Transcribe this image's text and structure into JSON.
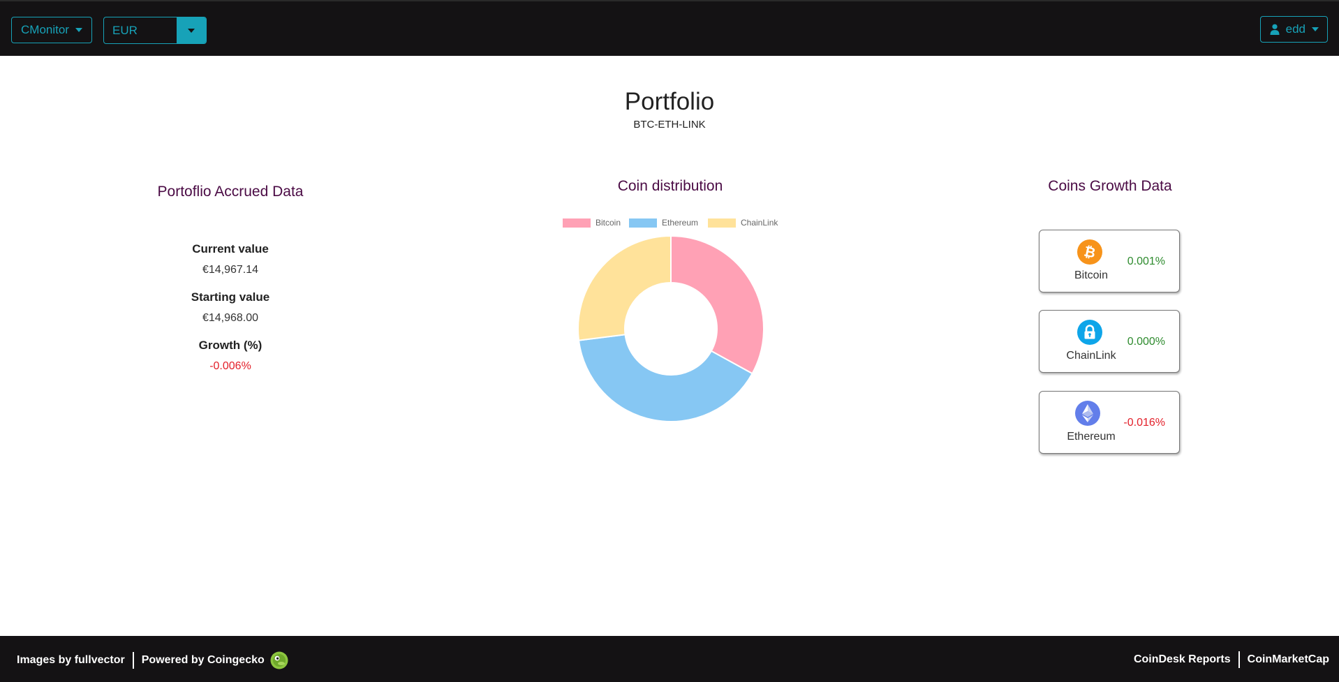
{
  "navbar": {
    "brand_label": "CMonitor",
    "currency_value": "EUR",
    "user_label": "edd"
  },
  "header": {
    "title": "Portfolio",
    "subtitle": "BTC-ETH-LINK"
  },
  "accrued": {
    "title": "Portoflio Accrued Data",
    "current_label": "Current value",
    "current_value": "€14,967.14",
    "starting_label": "Starting value",
    "starting_value": "€14,968.00",
    "growth_label": "Growth (%)",
    "growth_value": "-0.006%"
  },
  "distribution": {
    "title": "Coin distribution"
  },
  "chart_data": {
    "type": "pie",
    "categories": [
      "Bitcoin",
      "Ethereum",
      "ChainLink"
    ],
    "values": [
      33,
      40,
      27
    ],
    "colors": [
      "#ffa1b5",
      "#86c7f3",
      "#ffe29a"
    ],
    "legend": "top",
    "donut": true
  },
  "growth": {
    "title": "Coins Growth Data",
    "cards": [
      {
        "name": "Bitcoin",
        "pct": "0.001%",
        "icon": "bitcoin-icon",
        "color": "#f7931a",
        "trend": "pos"
      },
      {
        "name": "ChainLink",
        "pct": "0.000%",
        "icon": "chainlink-icon",
        "color": "#0ea5e9",
        "trend": "pos"
      },
      {
        "name": "Ethereum",
        "pct": "-0.016%",
        "icon": "ethereum-icon",
        "color": "#627eea",
        "trend": "neg"
      }
    ]
  },
  "footer": {
    "images_credit": "Images by fullvector",
    "powered_by": "Powered by Coingecko",
    "link_coindesk": "CoinDesk Reports",
    "link_coinmarketcap": "CoinMarketCap"
  }
}
